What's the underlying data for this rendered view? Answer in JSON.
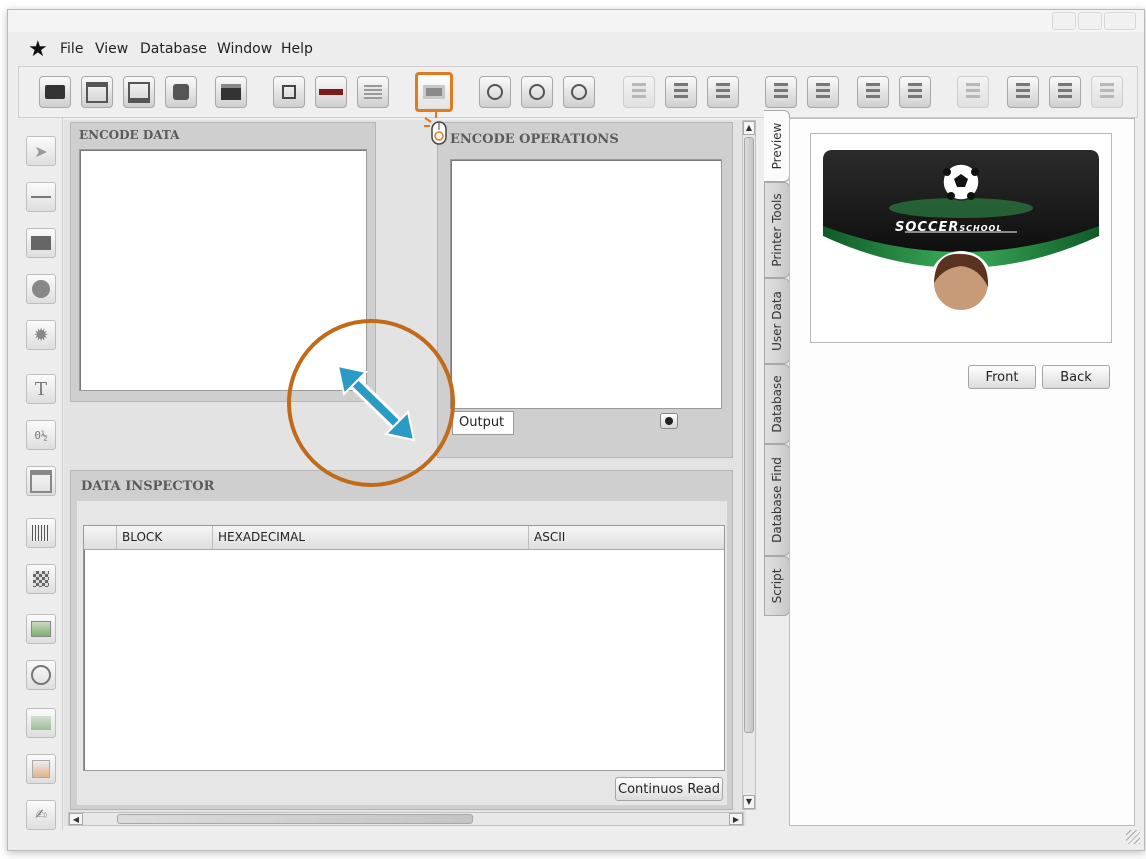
{
  "window": {
    "controls": [
      "minimize",
      "maximize",
      "close"
    ]
  },
  "menu": {
    "items": [
      {
        "label": "File"
      },
      {
        "label": "View"
      },
      {
        "label": "Database"
      },
      {
        "label": "Window"
      },
      {
        "label": "Help"
      }
    ]
  },
  "toolbar": {
    "buttons": [
      {
        "icon": "new-card-icon"
      },
      {
        "icon": "open-icon"
      },
      {
        "icon": "save-icon"
      },
      {
        "icon": "camera-icon"
      },
      {
        "icon": "print-icon"
      },
      {
        "icon": "card-front-icon"
      },
      {
        "icon": "magstripe-icon"
      },
      {
        "icon": "card-preview-icon"
      },
      {
        "icon": "encode-icon",
        "active": true
      },
      {
        "icon": "zoom-in-icon"
      },
      {
        "icon": "zoom-out-icon"
      },
      {
        "icon": "zoom-fit-icon"
      },
      {
        "icon": "db-export-icon",
        "disabled": true
      },
      {
        "icon": "db-cancel-icon"
      },
      {
        "icon": "db-refresh-icon"
      },
      {
        "icon": "db-first-icon"
      },
      {
        "icon": "db-prev-icon"
      },
      {
        "icon": "db-next-icon"
      },
      {
        "icon": "db-last-icon"
      },
      {
        "icon": "db-undo-icon",
        "disabled": true
      },
      {
        "icon": "db-add-icon"
      },
      {
        "icon": "db-remove-icon"
      },
      {
        "icon": "db-confirm-icon",
        "disabled": true
      }
    ]
  },
  "palette": {
    "tools": [
      "pointer-icon",
      "line-icon",
      "rectangle-icon",
      "ellipse-icon",
      "star-shape-icon",
      "text-icon",
      "counter-icon",
      "calendar-icon",
      "barcode-icon",
      "qrcode-icon",
      "image-import-icon",
      "camera-capture-icon",
      "background-image-icon",
      "photo-icon",
      "signature-icon"
    ]
  },
  "encode_data": {
    "title": "ENCODE DATA"
  },
  "encode_operations": {
    "title": "ENCODE OPERATIONS",
    "output_tab": "Output"
  },
  "data_inspector": {
    "title": "DATA INSPECTOR",
    "columns": [
      "BLOCK",
      "HEXADECIMAL",
      "ASCII"
    ],
    "continuous_read": "Continuos Read"
  },
  "side_tabs": [
    {
      "label": "Preview",
      "selected": true
    },
    {
      "label": "Printer Tools"
    },
    {
      "label": "User Data"
    },
    {
      "label": "Database"
    },
    {
      "label": "Database Find"
    },
    {
      "label": "Script"
    }
  ],
  "preview": {
    "card_brand_main": "SOCCER",
    "card_brand_sub": "SCHOOL",
    "front_button": "Front",
    "back_button": "Back",
    "colors": {
      "card_dark": "#1d1d1d",
      "card_green": "#2f9a4c"
    }
  },
  "annotation": {
    "resize_arrow_color": "#2a9bc4",
    "circle_color": "#c06a1a",
    "click_hint_color": "#e07a1c"
  }
}
